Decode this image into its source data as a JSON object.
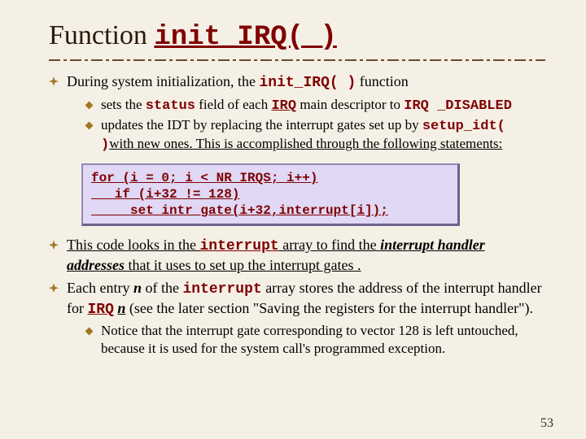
{
  "title_plain": "Function ",
  "title_code": "init_IRQ( )",
  "bullet1_pre": "During system initialization, the ",
  "bullet1_code": "init_IRQ( )",
  "bullet1_post": " function",
  "sub1a_pre": "sets the ",
  "sub1a_status": "status",
  "sub1a_mid1": " field of each ",
  "sub1a_irq": "IRQ",
  "sub1a_mid2": " main descriptor to ",
  "sub1a_irqc": "IRQ",
  "sub1a_disabled": " _DISABLED",
  "sub1b_pre": "updates the IDT by replacing the interrupt gates set up by ",
  "sub1b_code": "setup_idt( )",
  "sub1b_post": "with new ones. This is accomplished through the following statements:",
  "code_line1": "for (i = 0; i < NR_IRQS; i++)",
  "code_line2": "   if (i+32 != 128)",
  "code_line3": "     set_intr_gate(i+32,interrupt[i]);",
  "bullet2_pre": "This code looks in the ",
  "bullet2_interrupt": "interrupt",
  "bullet2_mid": " array to find the ",
  "bullet2_iha": "interrupt handler addresses",
  "bullet2_post": " that it uses to set up the interrupt gates .",
  "bullet3_pre": "Each entry ",
  "bullet3_n1": "n",
  "bullet3_mid1": " of the ",
  "bullet3_interrupt": "interrupt",
  "bullet3_mid2": " array stores the address of the interrupt handler for ",
  "bullet3_irq": "IRQ",
  "bullet3_space": " ",
  "bullet3_n2": "n",
  "bullet3_post": " (see the later section \"Saving the registers for the interrupt handler\").",
  "sub3a": "Notice that the interrupt gate corresponding to vector 128 is left untouched, because it is used for the system call's programmed exception.",
  "page": "53"
}
